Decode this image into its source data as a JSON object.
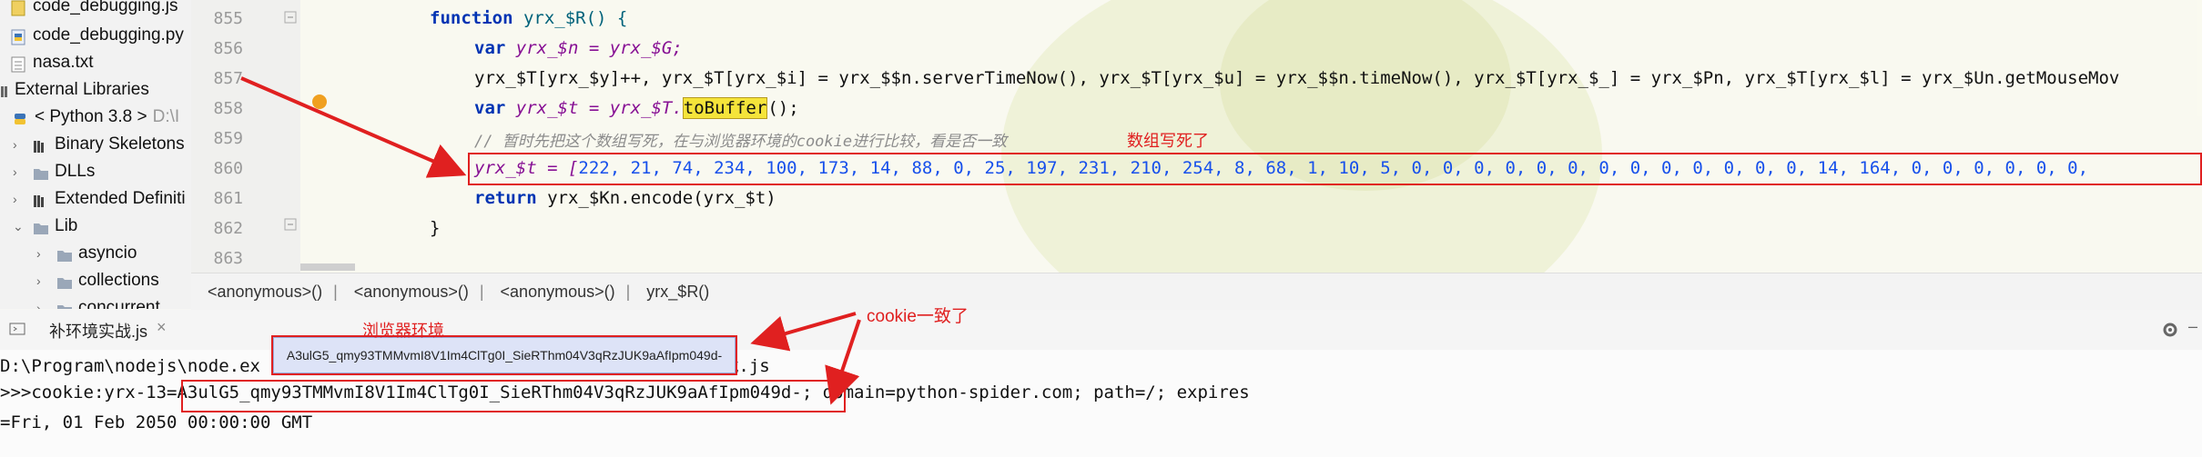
{
  "tree": {
    "items": [
      {
        "label": "code_debugging.js"
      },
      {
        "label": "code_debugging.py"
      },
      {
        "label": "nasa.txt"
      },
      {
        "label": "External Libraries"
      },
      {
        "label": "< Python 3.8 >",
        "suffix": "D:\\I"
      },
      {
        "label": "Binary Skeletons"
      },
      {
        "label": "DLLs"
      },
      {
        "label": "Extended Definiti"
      },
      {
        "label": "Lib"
      },
      {
        "label": "asyncio"
      },
      {
        "label": "collections"
      },
      {
        "label": "concurrent"
      }
    ]
  },
  "editor": {
    "line_numbers": [
      "855",
      "856",
      "857",
      "858",
      "859",
      "860",
      "861",
      "862",
      "863"
    ],
    "lines": {
      "l855_kw": "function",
      "l855_rest": " yrx_$R() {",
      "l856_kw": "var",
      "l856_rest": " yrx_$n = yrx_$G;",
      "l857": "yrx_$T[yrx_$y]++, yrx_$T[yrx_$i] = yrx_$$n.serverTimeNow(), yrx_$T[yrx_$u] = yrx_$$n.timeNow(), yrx_$T[yrx_$_] = yrx_$Pn, yrx_$T[yrx_$l] = yrx_$Un.getMouseMov",
      "l858_kw": "var",
      "l858_rest": " yrx_$t = yrx_$T.",
      "l858_fn": "toBuffer",
      "l858_end": "();",
      "l859_cmt": "// 暂时先把这个数组写死，在与浏览器环境的cookie进行比较，看是否一致",
      "l860_start": "yrx_$t = [",
      "l860_nums": "222, 21, 74, 234, 100, 173, 14, 88, 0, 25, 197, 231, 210, 254, 8, 68, 1, 10, 5, 0, 0, 0, 0, 0, 0, 0, 0, 0, 0, 0, 0, 0, 14, 164, 0, 0, 0, 0, 0, 0,",
      "l861_kw": "return",
      "l861_rest": " yrx_$Kn.encode(yrx_$t)",
      "l862": "}"
    },
    "annotation_array": "数组写死了"
  },
  "breadcrumb": [
    "<anonymous>()",
    "<anonymous>()",
    "<anonymous>()",
    "yrx_$R()"
  ],
  "run": {
    "tab_label": "补环境实战.js",
    "popup_text": "A3ulG5_qmy93TMMvmI8V1Im4ClTg0I_SieRThm04V3qRzJUK9aAfIpm049d-",
    "annotation_browser": "浏览器环境",
    "annotation_cookie": "cookie一致了",
    "console_line1_a": "D:\\Program\\nodejs\\node.ex",
    "console_line1_b": "境\\补环境实战.js",
    "console_line2_prefix": ">>>cookie:yrx-13=",
    "console_line2_value": "A3ulG5_qmy93TMMvmI8V1Im4ClTg0I_SieRThm04V3qRzJUK9aAfIpm049d-",
    "console_line2_suffix": "; domain=python-spider.com; path=/; expires",
    "console_line3": "=Fri, 01 Feb 2050 00:00:00 GMT"
  },
  "colors": {
    "accent_red": "#e02020",
    "keyword": "#0033b3",
    "number": "#1750eb"
  }
}
